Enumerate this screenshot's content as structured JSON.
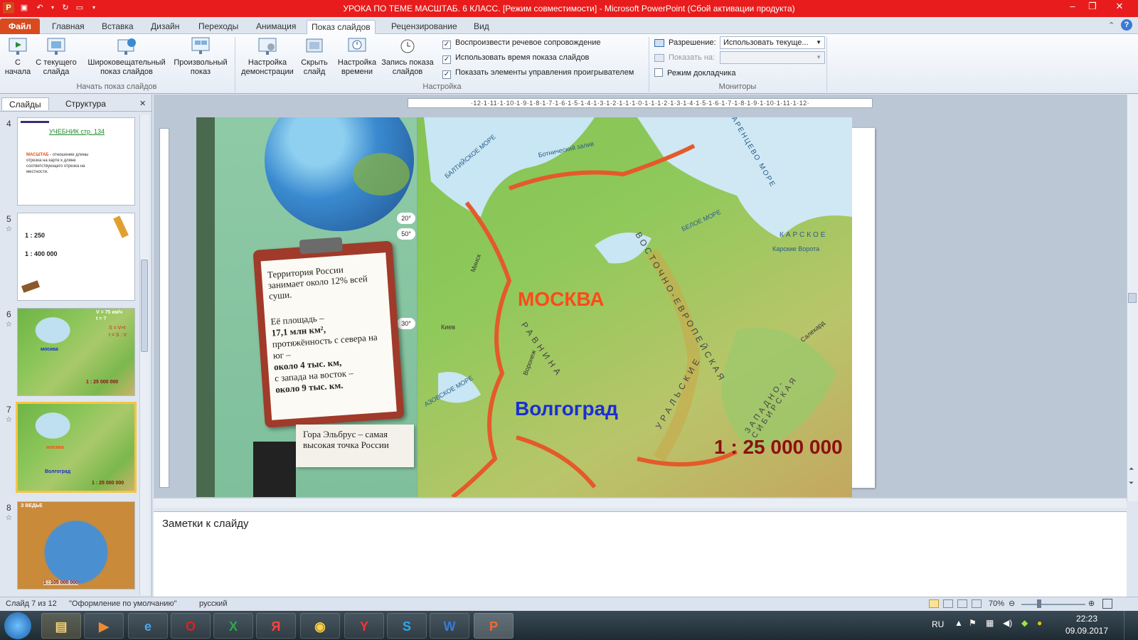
{
  "window": {
    "title": "УРОКА ПО ТЕМЕ МАСШТАБ. 6 КЛАСС. [Режим совместимости] - Microsoft PowerPoint (Сбой активации продукта)"
  },
  "tabs": [
    "Файл",
    "Главная",
    "Вставка",
    "Дизайн",
    "Переходы",
    "Анимация",
    "Показ слайдов",
    "Рецензирование",
    "Вид"
  ],
  "ribbon": {
    "start_group": {
      "label": "Начать показ слайдов",
      "from_start": "С начала",
      "from_current": "С текущего слайда",
      "broadcast": "Широковещательный показ слайдов",
      "custom": "Произвольный показ"
    },
    "setup_group": {
      "label": "Настройка",
      "setup_show": "Настройка демонстрации",
      "hide_slide": "Скрыть слайд",
      "rehearse": "Настройка времени",
      "record": "Запись показа слайдов",
      "check_narration": "Воспроизвести речевое сопровождение",
      "check_timings": "Использовать время показа слайдов",
      "check_controls": "Показать элементы управления проигрывателем",
      "narration_checked": "✓",
      "timings_checked": "✓",
      "controls_checked": "✓"
    },
    "monitors_group": {
      "label": "Мониторы",
      "resolution_label": "Разрешение:",
      "resolution_value": "Использовать текуще...",
      "show_on_label": "Показать на:",
      "presenter_view": "Режим докладчика"
    }
  },
  "leftpane": {
    "tab_slides": "Слайды",
    "tab_outline": "Структура",
    "close": "✕",
    "thumbs": [
      {
        "num": "4",
        "title": "УЧЕБНИК  стр. 134",
        "text_bold": "МАСШТАБ",
        "text": " - отношение длины отрезка на карте к длине соответствующего отрезка на местности."
      },
      {
        "num": "5",
        "line1": "1 : 250",
        "line2": "1 : 400 000"
      },
      {
        "num": "6",
        "line1": "V = 75 км/ч",
        "line2": "t = ?",
        "line3": "S = V×t",
        "line4": "t = S : V",
        "city": "москва",
        "scale": "1 : 25 000 000"
      },
      {
        "num": "7",
        "city1": "москва",
        "city2": "Волгоград",
        "scale": "1 : 25 000 000"
      },
      {
        "num": "8",
        "heading": "З ВЕДЬЕ",
        "scale": "1 : 105 000 000"
      }
    ]
  },
  "ruler": "·12·1·11·1·10·1·9·1·8·1·7·1·6·1·5·1·4·1·3·1·2·1·1·1·0·1·1·1·2·1·3·1·4·1·5·1·6·1·7·1·8·1·9·1·10·1·11·1·12·",
  "slide": {
    "clipboard": {
      "p1": "Территория России занимает около 12% всей суши.",
      "p2a": "Её площадь –",
      "p2b": "17,1 млн км²,",
      "p2c": "протяжённость с севера на юг –",
      "p2d": "около 4 тыс. км,",
      "p2e": "с запада на восток –",
      "p2f": "около 9 тыс. км."
    },
    "elbrus": "Гора Эльбрус – самая высокая точка России",
    "city1": "МОСКВА",
    "city2": "Волгоград",
    "scale": "1 : 25 000 000",
    "lat1": "20°",
    "lat2": "50°",
    "lat3": "30°",
    "map_labels": {
      "baltic": "БАЛТИЙСКОЕ МОРЕ",
      "bothnian": "Ботнический залив",
      "white_sea": "БЕЛОЕ МОРЕ",
      "east_european": "ВОСТОЧНО-ЕВРОПЕЙСКАЯ",
      "plain": "РАВНИНА",
      "ural": "УРАЛЬСКИЕ",
      "west_siberian": "ЗАПАДНО-СИБИРСКАЯ",
      "barents": "БАРЕНЦЕВО МОРЕ",
      "kara": "КАРСКОЕ",
      "kara_gate": "Карские Ворота",
      "azov": "АЗОВСКОЕ МОРЕ",
      "kiev": "Киев",
      "minsk": "Минск",
      "voronezh": "Воронеж",
      "salekhard": "Салехард"
    }
  },
  "notes": {
    "placeholder": "Заметки к слайду"
  },
  "status": {
    "slide_of": "Слайд 7 из 12",
    "theme": "\"Оформление по умолчанию\"",
    "language": "русский",
    "zoom": "70%"
  },
  "taskbar": {
    "lang": "RU",
    "time": "22:23",
    "date": "09.09.2017",
    "apps": [
      "explorer-icon",
      "media-player-icon",
      "internet-explorer-icon",
      "opera-icon",
      "excel-icon",
      "yandex-icon",
      "chrome-icon",
      "yandex-browser-icon",
      "skype-icon",
      "word-icon",
      "powerpoint-icon"
    ]
  },
  "colors": {
    "title_bar": "#e81c1c",
    "file_tab": "#d94a1e",
    "moscow": "#ff4a1a",
    "volgograd": "#1a2fd0",
    "scale_text": "#8a1010",
    "selection": "#f5c543"
  }
}
